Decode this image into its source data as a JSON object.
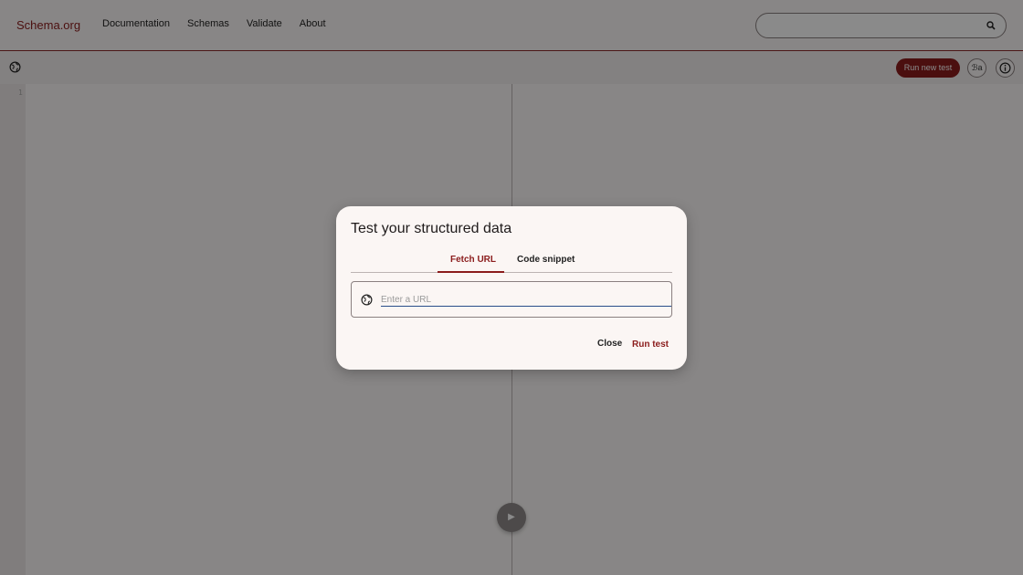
{
  "header": {
    "logo": "Schema.org",
    "nav": [
      "Documentation",
      "Schemas",
      "Validate",
      "About"
    ],
    "search": {
      "value": "",
      "placeholder": ""
    }
  },
  "toolbar": {
    "run_new_test": "Run new test",
    "language_label": "ℬa"
  },
  "editor": {
    "line_number": "1"
  },
  "dialog": {
    "title": "Test your structured data",
    "tabs": [
      "Fetch URL",
      "Code snippet"
    ],
    "active_tab": "Fetch URL",
    "url_placeholder": "Enter a URL",
    "url_value": "",
    "close_label": "Close",
    "run_label": "Run test"
  },
  "colors": {
    "brand": "#8b1c1c",
    "input_underline": "#2a4e8a"
  },
  "icons": [
    "search-icon",
    "globe-icon",
    "translate-icon",
    "info-icon",
    "play-icon"
  ]
}
